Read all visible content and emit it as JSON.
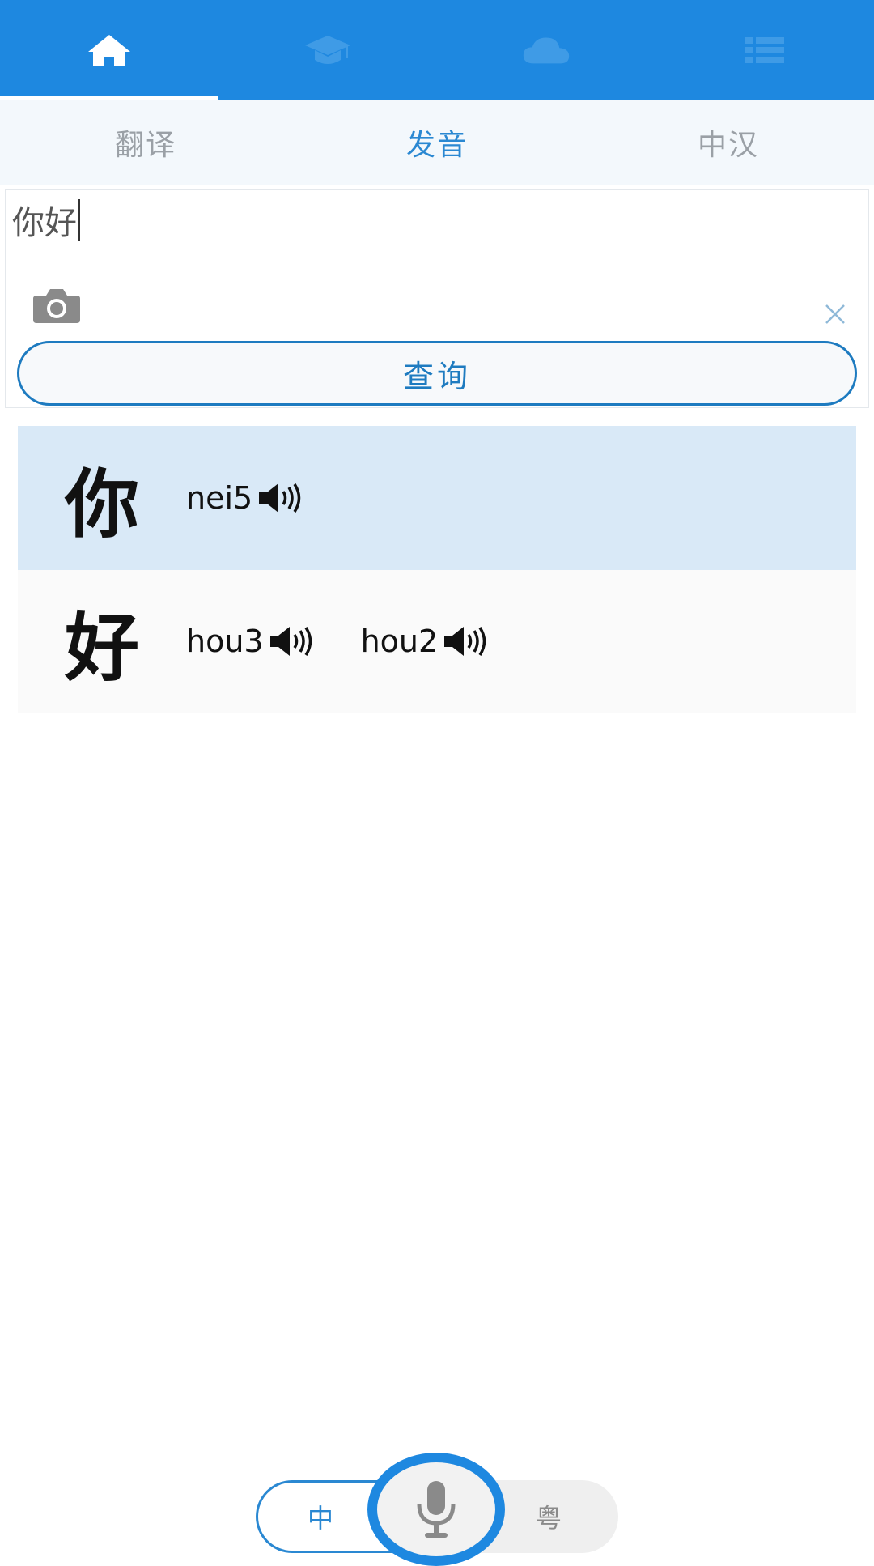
{
  "nav": {
    "tabs": [
      {
        "icon": "home-icon",
        "active": true
      },
      {
        "icon": "graduation-cap-icon",
        "active": false
      },
      {
        "icon": "cloud-icon",
        "active": false
      },
      {
        "icon": "list-icon",
        "active": false
      }
    ]
  },
  "subtabs": {
    "translate": "翻译",
    "pronunciation": "发音",
    "chinese_dict": "中汉",
    "active": "pronunciation"
  },
  "input": {
    "value": "你好"
  },
  "query_button": "查询",
  "results": [
    {
      "char": "你",
      "readings": [
        "nei5"
      ],
      "highlighted": true
    },
    {
      "char": "好",
      "readings": [
        "hou3",
        "hou2"
      ],
      "highlighted": false
    }
  ],
  "language_switch": {
    "left": "中",
    "right": "粤"
  },
  "colors": {
    "primary": "#1e88e0",
    "accent_text": "#2a88d2",
    "highlight_row": "#d9e9f7"
  }
}
